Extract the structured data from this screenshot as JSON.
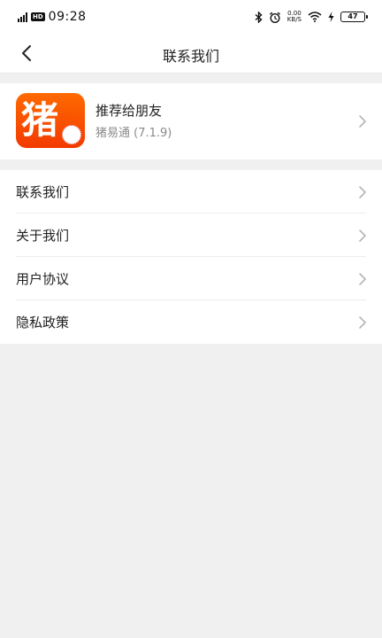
{
  "status_bar": {
    "network": "5G",
    "hd": "HD",
    "time": "09:28",
    "speed_value": "0.00",
    "speed_unit": "KB/S",
    "battery": "47",
    "icons": [
      "signal-icon",
      "bluetooth-icon",
      "alarm-icon",
      "wifi-icon",
      "charging-icon",
      "battery-icon"
    ]
  },
  "nav": {
    "title": "联系我们",
    "back_icon": "chevron-left-icon"
  },
  "app_card": {
    "icon_char": "猪",
    "name": "推荐给朋友",
    "subtitle": "猪易通 (7.1.9)",
    "accent": "#ff5a00"
  },
  "menu": {
    "items": [
      {
        "label": "联系我们"
      },
      {
        "label": "关于我们"
      },
      {
        "label": "用户协议"
      },
      {
        "label": "隐私政策"
      }
    ]
  }
}
